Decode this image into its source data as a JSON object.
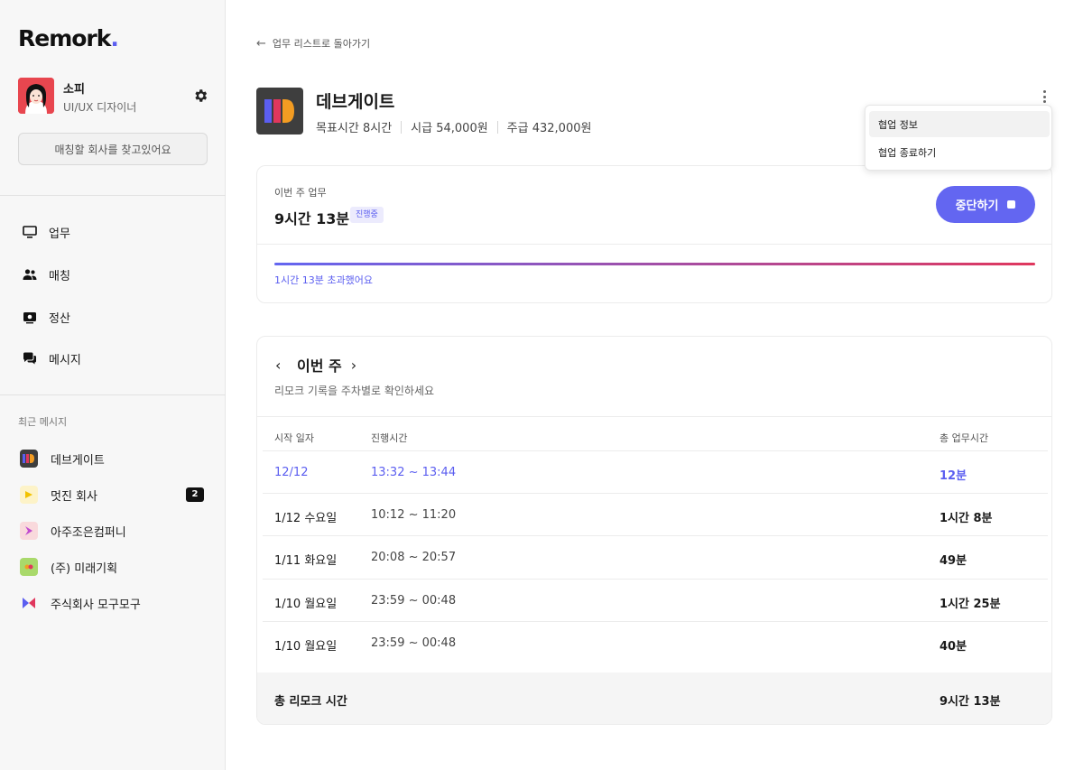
{
  "app": {
    "logo_text": "Remork",
    "logo_dot": "."
  },
  "profile": {
    "name": "소피",
    "role": "UI/UX 디자이너"
  },
  "sidebar": {
    "match_button": "매칭할 회사를 찾고있어요",
    "nav": [
      {
        "label": "업무",
        "icon": "monitor-icon"
      },
      {
        "label": "매칭",
        "icon": "users-icon"
      },
      {
        "label": "정산",
        "icon": "wallet-icon"
      },
      {
        "label": "메시지",
        "icon": "chat-icon"
      }
    ],
    "recent_title": "최근 메시지",
    "recent": [
      {
        "label": "데브게이트",
        "badge": ""
      },
      {
        "label": "멋진 회사",
        "badge": "2"
      },
      {
        "label": "아주조은컴퍼니",
        "badge": ""
      },
      {
        "label": "(주) 미래기획",
        "badge": ""
      },
      {
        "label": "주식회사 모구모구",
        "badge": ""
      }
    ]
  },
  "main": {
    "back_link": "업무 리스트로 돌아가기",
    "company": {
      "name": "데브게이트",
      "goal": "목표시간 8시간",
      "hourly": "시급 54,000원",
      "weekly": "주급 432,000원"
    },
    "menu": {
      "items": [
        "협업 정보",
        "협업 종료하기"
      ]
    },
    "this_week": {
      "label": "이번 주 업무",
      "time": "9시간 13분",
      "status": "진행중",
      "stop_button": "중단하기",
      "progress": 1.0,
      "over_text": "1시간 13분 초과했어요"
    },
    "records": {
      "title": "이번 주",
      "subtitle": "리모크 기록을 주차별로 확인하세요",
      "columns": [
        "시작 일자",
        "진행시간",
        "총 업무시간"
      ],
      "rows": [
        {
          "date": "12/12",
          "range": "13:32 ~ 13:44",
          "total": "12분",
          "highlight": true
        },
        {
          "date": "1/12 수요일",
          "range": "10:12 ~ 11:20",
          "total": "1시간 8분",
          "highlight": false
        },
        {
          "date": "1/11 화요일",
          "range": "20:08 ~ 20:57",
          "total": "49분",
          "highlight": false
        },
        {
          "date": "1/10 월요일",
          "range": "23:59 ~ 00:48",
          "total": "1시간 25분",
          "highlight": false
        },
        {
          "date": "1/10 월요일",
          "range": "23:59 ~ 00:48",
          "total": "40분",
          "highlight": false
        }
      ],
      "total_label": "총 리모크 시간",
      "total_value": "9시간 13분"
    }
  },
  "colors": {
    "accent": "#6366f1",
    "accent_text": "#5b5ef0",
    "progress_end": "#e0375d"
  }
}
